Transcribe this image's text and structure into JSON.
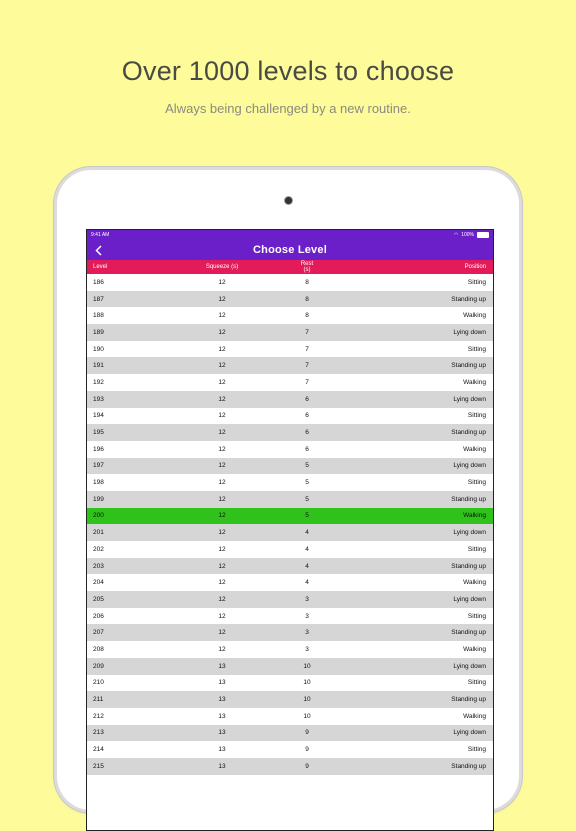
{
  "promo": {
    "headline": "Over 1000 levels to choose",
    "subline": "Always being challenged by a new routine."
  },
  "status_bar": {
    "time": "9:41 AM",
    "battery": "100%"
  },
  "nav": {
    "back_icon": "chevron-left-icon",
    "title": "Choose Level"
  },
  "colors": {
    "nav": "#6b1fc8",
    "header": "#e31c59",
    "selected": "#2fc21a",
    "background": "#fdfb9a"
  },
  "table": {
    "headers": {
      "level": "Level",
      "squeeze": "Squeeze (s)",
      "rest": "Rest (s)",
      "position": "Position"
    },
    "selected_level": "200",
    "rows": [
      {
        "level": "186",
        "squeeze": "12",
        "rest": "8",
        "position": "Sitting"
      },
      {
        "level": "187",
        "squeeze": "12",
        "rest": "8",
        "position": "Standing up"
      },
      {
        "level": "188",
        "squeeze": "12",
        "rest": "8",
        "position": "Walking"
      },
      {
        "level": "189",
        "squeeze": "12",
        "rest": "7",
        "position": "Lying down"
      },
      {
        "level": "190",
        "squeeze": "12",
        "rest": "7",
        "position": "Sitting"
      },
      {
        "level": "191",
        "squeeze": "12",
        "rest": "7",
        "position": "Standing up"
      },
      {
        "level": "192",
        "squeeze": "12",
        "rest": "7",
        "position": "Walking"
      },
      {
        "level": "193",
        "squeeze": "12",
        "rest": "6",
        "position": "Lying down"
      },
      {
        "level": "194",
        "squeeze": "12",
        "rest": "6",
        "position": "Sitting"
      },
      {
        "level": "195",
        "squeeze": "12",
        "rest": "6",
        "position": "Standing up"
      },
      {
        "level": "196",
        "squeeze": "12",
        "rest": "6",
        "position": "Walking"
      },
      {
        "level": "197",
        "squeeze": "12",
        "rest": "5",
        "position": "Lying down"
      },
      {
        "level": "198",
        "squeeze": "12",
        "rest": "5",
        "position": "Sitting"
      },
      {
        "level": "199",
        "squeeze": "12",
        "rest": "5",
        "position": "Standing up"
      },
      {
        "level": "200",
        "squeeze": "12",
        "rest": "5",
        "position": "Walking"
      },
      {
        "level": "201",
        "squeeze": "12",
        "rest": "4",
        "position": "Lying down"
      },
      {
        "level": "202",
        "squeeze": "12",
        "rest": "4",
        "position": "Sitting"
      },
      {
        "level": "203",
        "squeeze": "12",
        "rest": "4",
        "position": "Standing up"
      },
      {
        "level": "204",
        "squeeze": "12",
        "rest": "4",
        "position": "Walking"
      },
      {
        "level": "205",
        "squeeze": "12",
        "rest": "3",
        "position": "Lying down"
      },
      {
        "level": "206",
        "squeeze": "12",
        "rest": "3",
        "position": "Sitting"
      },
      {
        "level": "207",
        "squeeze": "12",
        "rest": "3",
        "position": "Standing up"
      },
      {
        "level": "208",
        "squeeze": "12",
        "rest": "3",
        "position": "Walking"
      },
      {
        "level": "209",
        "squeeze": "13",
        "rest": "10",
        "position": "Lying down"
      },
      {
        "level": "210",
        "squeeze": "13",
        "rest": "10",
        "position": "Sitting"
      },
      {
        "level": "211",
        "squeeze": "13",
        "rest": "10",
        "position": "Standing up"
      },
      {
        "level": "212",
        "squeeze": "13",
        "rest": "10",
        "position": "Walking"
      },
      {
        "level": "213",
        "squeeze": "13",
        "rest": "9",
        "position": "Lying down"
      },
      {
        "level": "214",
        "squeeze": "13",
        "rest": "9",
        "position": "Sitting"
      },
      {
        "level": "215",
        "squeeze": "13",
        "rest": "9",
        "position": "Standing up"
      }
    ]
  }
}
